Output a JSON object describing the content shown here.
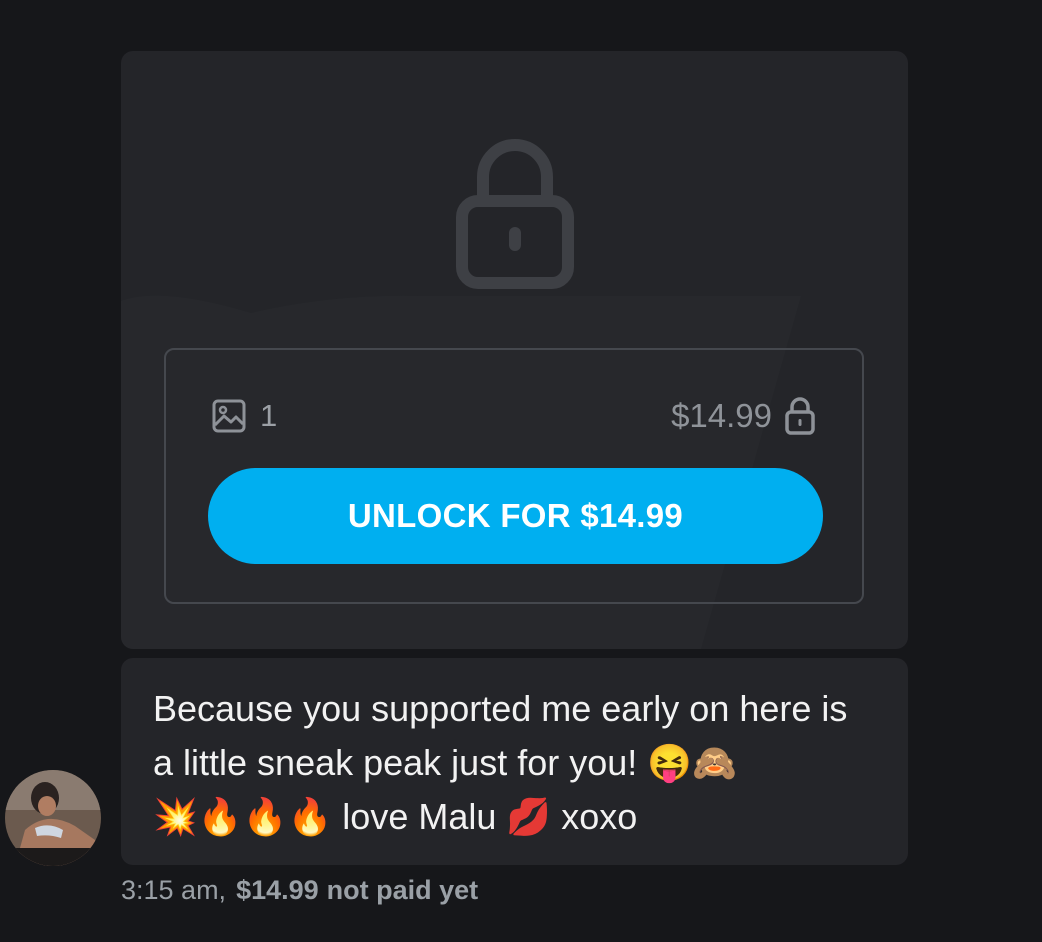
{
  "post": {
    "media_count": "1",
    "price": "$14.99",
    "unlock_label": "UNLOCK FOR $14.99",
    "icons": {
      "large": "lock-icon",
      "media": "image-icon",
      "price": "lock-icon"
    }
  },
  "message": {
    "text": "Because you supported me early on here is a little sneak peak just for you! 😝🙈\n💥🔥🔥🔥 love Malu 💋 xoxo"
  },
  "meta": {
    "time": "3:15 am,",
    "price": "$14.99",
    "status": "not paid yet"
  },
  "colors": {
    "background": "#16171a",
    "card": "#242529",
    "accent": "#00aff0",
    "muted_text": "#9aa0a6"
  }
}
